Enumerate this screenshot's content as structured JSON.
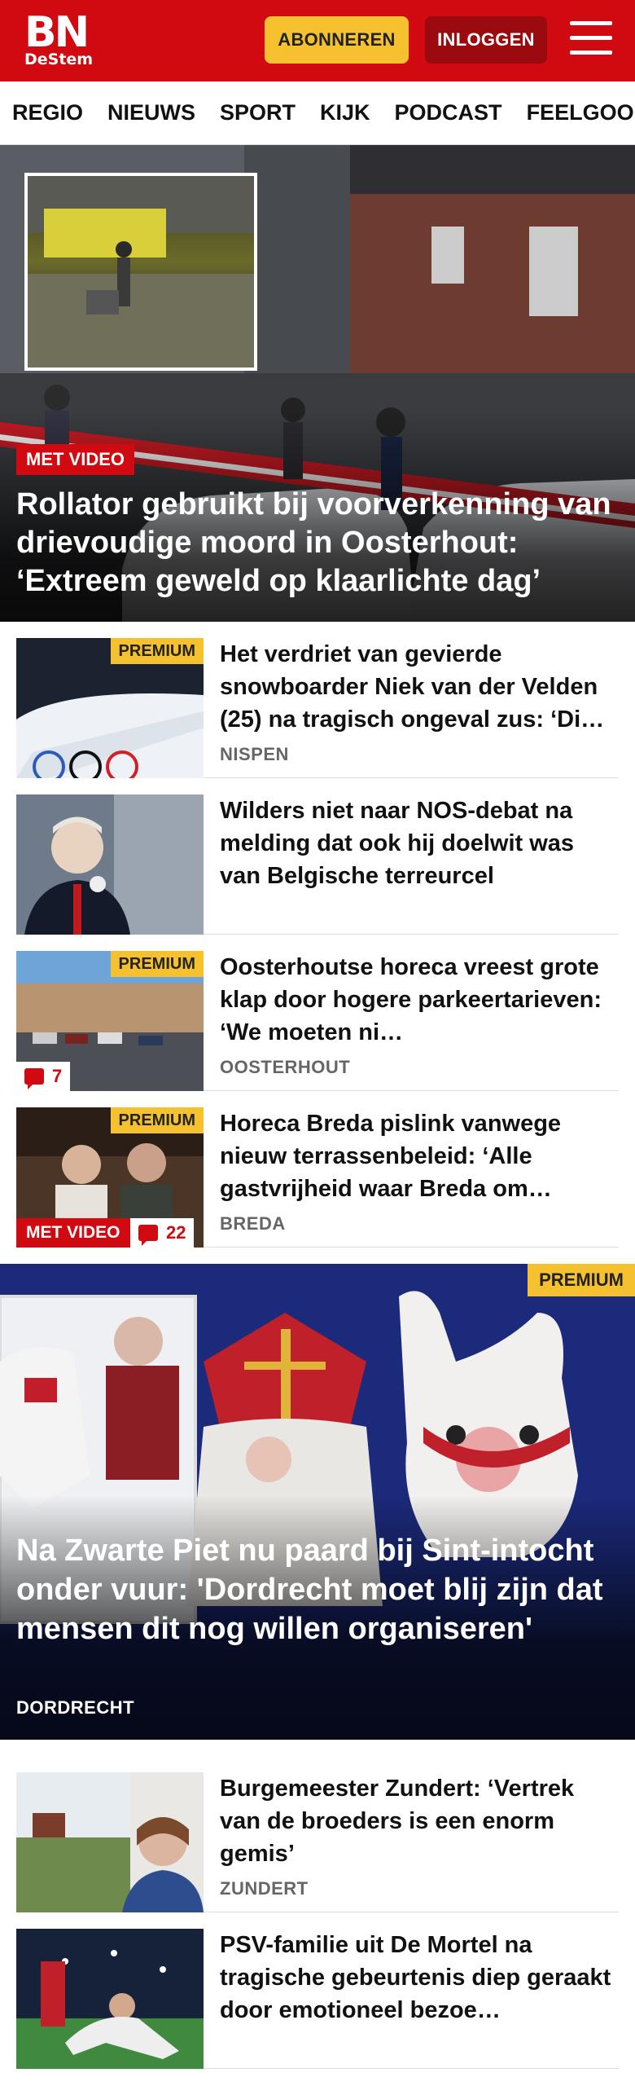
{
  "header": {
    "logo_main": "BN",
    "logo_sub": "DeStem",
    "subscribe_label": "ABONNEREN",
    "login_label": "INLOGGEN",
    "brand_color": "#d10a11",
    "accent_color": "#f5c12e"
  },
  "nav": {
    "items": [
      "REGIO",
      "NIEUWS",
      "SPORT",
      "KIJK",
      "PODCAST",
      "FEELGOOD"
    ]
  },
  "hero": {
    "tag": "MET VIDEO",
    "title": "Rollator gebruikt bij voorverkenning van drievoudige moord in Oosterhout: ‘Extreem geweld op klaarlichte dag’"
  },
  "articles": [
    {
      "title": "Het verdriet van gevierde snowboarder Niek van der Velden (25) na tragisch ongeval zus: ‘Di…",
      "location": "NISPEN",
      "premium": "PREMIUM"
    },
    {
      "title": "Wilders niet naar NOS-debat na melding dat ook hij doelwit was van Belgische terreurcel",
      "location": "",
      "premium": ""
    },
    {
      "title": "Oosterhoutse horeca vreest grote klap door hogere parkeertarieven: ‘We moeten ni…",
      "location": "OOSTERHOUT",
      "premium": "PREMIUM",
      "comments": "7"
    },
    {
      "title": "Horeca Breda pislink vanwege nieuw terrassenbeleid: ‘Alle gastvrijheid waar Breda om…",
      "location": "BREDA",
      "premium": "PREMIUM",
      "video_tag": "MET VIDEO",
      "comments": "22"
    }
  ],
  "feature": {
    "badge": "PREMIUM",
    "title": "Na Zwarte Piet nu paard bij Sint-intocht onder vuur: 'Dordrecht moet blij zijn dat mensen dit nog willen organiseren'",
    "location": "DORDRECHT"
  },
  "articles2": [
    {
      "title": "Burgemeester Zundert: ‘Vertrek van de broeders is een enorm gemis’",
      "location": "ZUNDERT"
    },
    {
      "title": "PSV-familie uit De Mortel na tragische gebeurtenis diep geraakt door emotioneel bezoe…",
      "location": ""
    }
  ],
  "icons": {
    "menu": "hamburger-menu-icon",
    "comment": "comment-bubble-icon"
  }
}
